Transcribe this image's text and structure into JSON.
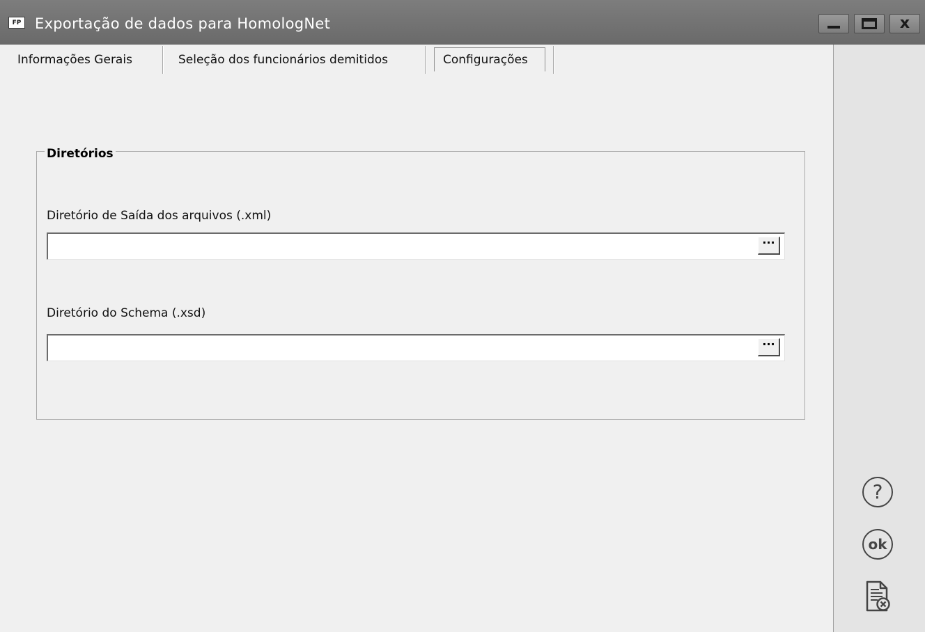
{
  "window": {
    "title": "Exportação de dados para HomologNet",
    "app_icon_text": "FP"
  },
  "title_buttons": {
    "minimize_icon": "minimize-icon",
    "maximize_icon": "maximize-icon",
    "close_label": "x"
  },
  "tabs": [
    {
      "label": "Informações Gerais",
      "active": false
    },
    {
      "label": "Seleção dos funcionários demitidos",
      "active": false
    },
    {
      "label": "Configurações",
      "active": true
    }
  ],
  "group": {
    "title": "Diretórios",
    "fields": [
      {
        "label": "Diretório de Saída dos arquivos (.xml)",
        "value": "",
        "browse_label": "···"
      },
      {
        "label": "Diretório do Schema (.xsd)",
        "value": "",
        "browse_label": "···"
      }
    ]
  },
  "side_actions": {
    "help_label": "?",
    "ok_label": "ok",
    "cancel_icon": "document-cancel-icon"
  },
  "colors": {
    "titlebar": "#737373",
    "window_bg": "#f0f0f0",
    "side_panel_bg": "#e4e4e4",
    "icon_color": "#444444"
  }
}
